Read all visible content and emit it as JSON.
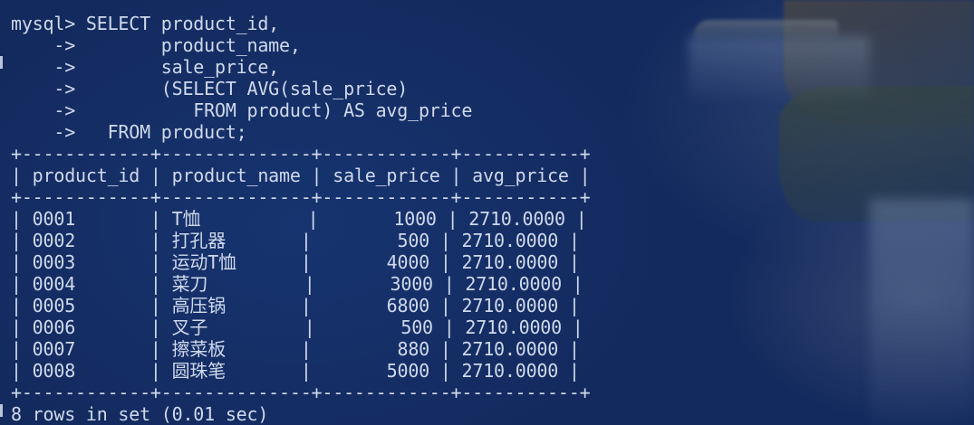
{
  "terminal": {
    "lines": [
      "mysql> SELECT product_id,",
      "    ->        product_name,",
      "    ->        sale_price,",
      "    ->        (SELECT AVG(sale_price)",
      "    ->           FROM product) AS avg_price",
      "    ->   FROM product;",
      "+------------+--------------+------------+-----------+",
      "| product_id | product_name | sale_price | avg_price |",
      "+------------+--------------+------------+-----------+",
      "| 0001       | T恤          |       1000 | 2710.0000 |",
      "| 0002       | 打孔器       |        500 | 2710.0000 |",
      "| 0003       | 运动T恤      |       4000 | 2710.0000 |",
      "| 0004       | 菜刀         |       3000 | 2710.0000 |",
      "| 0005       | 高压锅       |       6800 | 2710.0000 |",
      "| 0006       | 叉子         |        500 | 2710.0000 |",
      "| 0007       | 擦菜板       |        880 | 2710.0000 |",
      "| 0008       | 圆珠笔       |       5000 | 2710.0000 |",
      "+------------+--------------+------------+-----------+",
      "8 rows in set (0.01 sec)"
    ]
  },
  "colors": {
    "background": "#14285a",
    "text": "#cfd9ec"
  }
}
